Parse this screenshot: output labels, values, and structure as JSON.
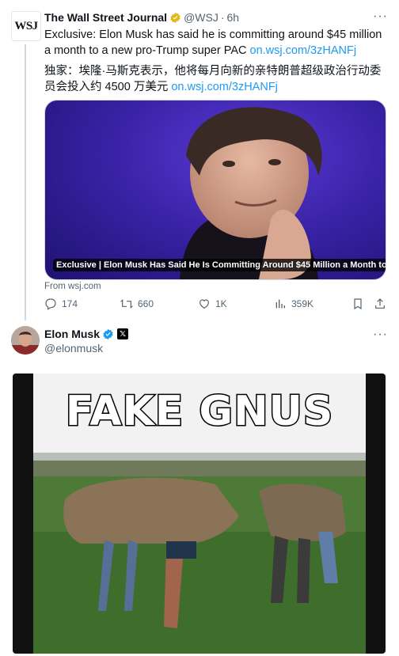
{
  "tweet1": {
    "author": "The Wall Street Journal",
    "handle": "@WSJ",
    "time": "6h",
    "avatar_text": "WSJ",
    "text_prefix": "Exclusive: Elon Musk has said he is committing around $45 million a month to a new pro-Trump super PAC ",
    "text_link": "on.wsj.com/3zHANFj",
    "translation_prefix": "独家：埃隆·马斯克表示，他将每月向新的亲特朗普超级政治行动委员会投入约 4500 万美元 ",
    "translation_link": "on.wsj.com/3zHANFj",
    "card_caption": "Exclusive | Elon Musk Has Said He Is Committing Around $45 Million a Month to...",
    "card_from": "From wsj.com",
    "actions": {
      "replies": "174",
      "reposts": "660",
      "likes": "1K",
      "views": "359K"
    }
  },
  "tweet2": {
    "author": "Elon Musk",
    "handle": "@elonmusk",
    "meme_text": "FAKE GNUS"
  },
  "colors": {
    "link": "#1d9bf0",
    "muted": "#536471",
    "verified_blue": "#1d9bf0",
    "verified_gold": "#e2b719"
  },
  "icons": {
    "reply": "reply-icon",
    "repost": "repost-icon",
    "like": "heart-icon",
    "views": "views-icon",
    "bookmark": "bookmark-icon",
    "share": "share-icon",
    "more": "more-icon"
  }
}
